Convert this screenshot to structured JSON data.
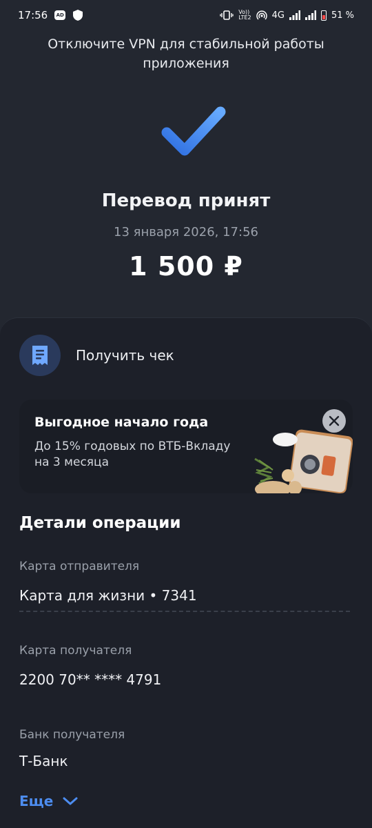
{
  "status_bar": {
    "time": "17:56",
    "ad_badge": "AD",
    "volte": "Vo))\nLTE2",
    "network": "4G",
    "battery": "51 %"
  },
  "notice": "Отключите VPN для стабильной работы приложения",
  "transfer": {
    "status": "Перевод принят",
    "datetime": "13 января 2026, 17:56",
    "amount": "1 500 ₽"
  },
  "receipt": {
    "label": "Получить чек"
  },
  "promo": {
    "title": "Выгодное начало года",
    "text": "До 15% годовых по ВТБ-Вкладу на 3 месяца"
  },
  "details": {
    "title": "Детали операции",
    "sender_card_label": "Карта отправителя",
    "sender_card_value": "Карта для жизни • 7341",
    "recipient_card_label": "Карта получателя",
    "recipient_card_value": "2200 70** **** 4791",
    "recipient_bank_label": "Банк получателя",
    "recipient_bank_value": "Т-Банк",
    "more_label": "Еще"
  },
  "icons": {
    "success": "checkmark-icon",
    "receipt": "receipt-icon",
    "close": "close-icon",
    "expand": "chevron-down-icon"
  },
  "colors": {
    "background": "#232730",
    "sheet": "#1d2029",
    "accent": "#4d8df0",
    "check_start": "#2f6fe0",
    "check_end": "#66aaff"
  }
}
